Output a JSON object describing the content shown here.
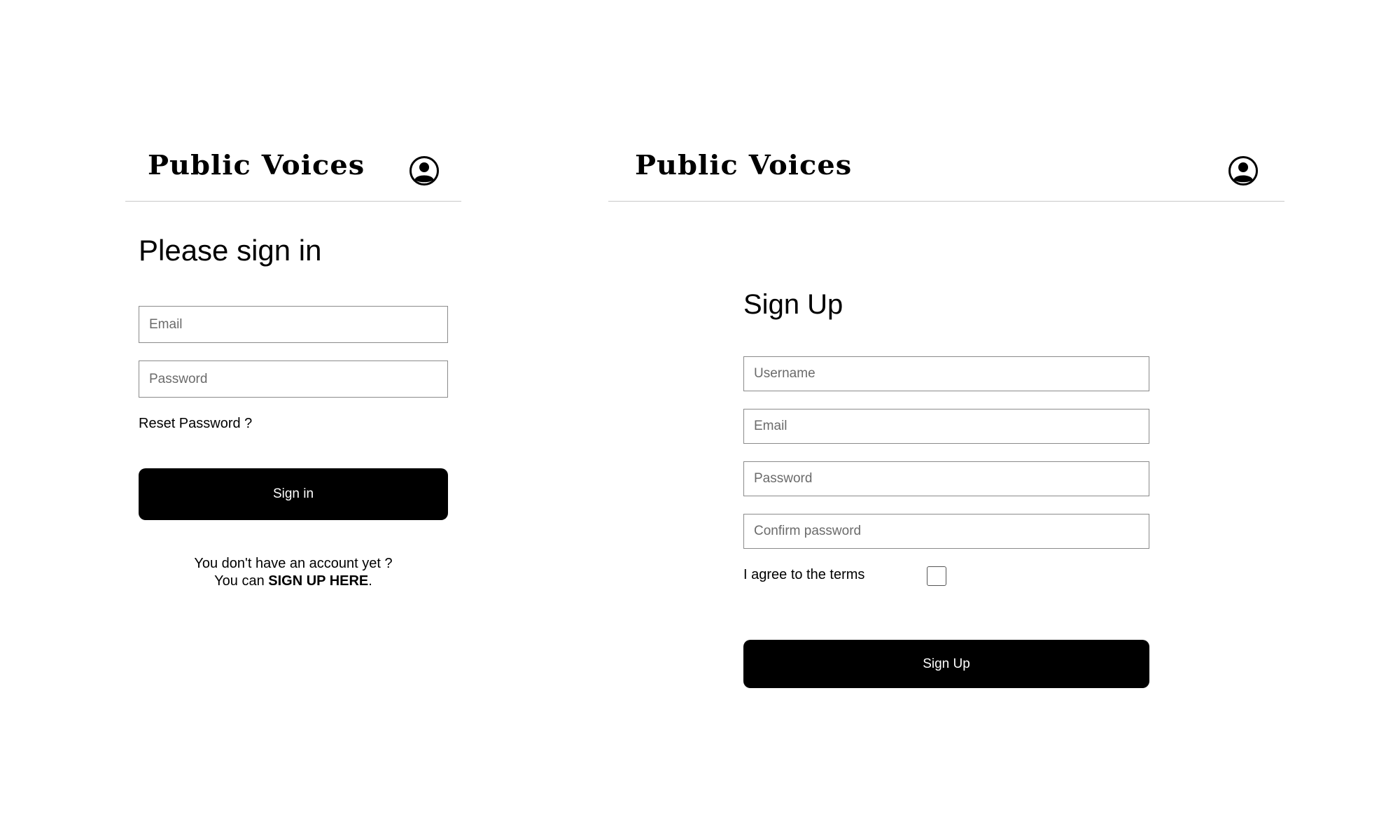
{
  "signin_panel": {
    "logo_text": "Public Voices",
    "avatar_icon": "user-circle-icon",
    "title": "Please sign in",
    "email_placeholder": "Email",
    "password_placeholder": "Password",
    "reset_link": "Reset Password ?",
    "submit_label": "Sign in",
    "hint_line1": "You don't have an account yet ?",
    "hint_prefix": "You can ",
    "hint_link": "SIGN UP HERE",
    "hint_suffix": "."
  },
  "signup_panel": {
    "logo_text": "Public Voices",
    "avatar_icon": "user-circle-icon",
    "title": "Sign Up",
    "username_placeholder": "Username",
    "email_placeholder": "Email",
    "password_placeholder": "Password",
    "confirm_placeholder": "Confirm password",
    "terms_label": "I agree to the terms",
    "terms_checked": false,
    "submit_label": "Sign Up"
  },
  "colors": {
    "background": "#ffffff",
    "button_bg": "#000000",
    "button_text": "#ffffff",
    "divider": "#c8c8c8",
    "input_border": "#8a8a8a"
  }
}
